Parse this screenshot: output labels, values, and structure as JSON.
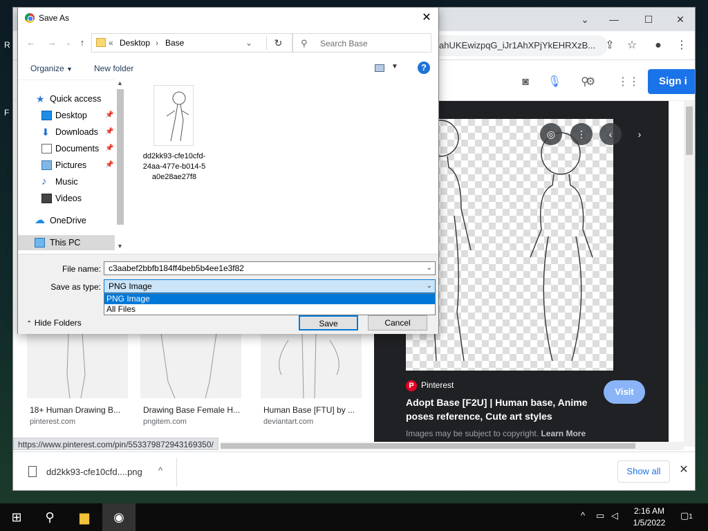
{
  "desktop": {
    "glyphs": [
      "R",
      "F"
    ]
  },
  "browser": {
    "url": "ahUKEwizpqG_iJr1AhXPjYkEHRXzB...",
    "signin_label": "Sign i",
    "status_url": "https://www.pinterest.com/pin/553379872943169350/",
    "thumbs": [
      {
        "title": "18+ Human Drawing B...",
        "source": "pinterest.com"
      },
      {
        "title": "Drawing Base Female H...",
        "source": "pngitem.com"
      },
      {
        "title": "Human Base [FTU] by ...",
        "source": "deviantart.com"
      }
    ],
    "preview": {
      "site": "Pinterest",
      "title": "Adopt Base [F2U] | Human base, Anime poses reference, Cute art styles",
      "visit_label": "Visit",
      "copyright": "Images may be subject to copyright.",
      "learn_more": "Learn More"
    },
    "download": {
      "filename": "dd2kk93-cfe10cfd....png",
      "show_all": "Show all"
    }
  },
  "dialog": {
    "title": "Save As",
    "breadcrumb": [
      "Desktop",
      "Base"
    ],
    "search_placeholder": "Search Base",
    "organize": "Organize",
    "new_folder": "New folder",
    "nav_items": [
      {
        "label": "Quick access",
        "icon": "star-icon",
        "pinned": false
      },
      {
        "label": "Desktop",
        "icon": "desktop-icon",
        "pinned": true
      },
      {
        "label": "Downloads",
        "icon": "download-icon",
        "pinned": true
      },
      {
        "label": "Documents",
        "icon": "documents-icon",
        "pinned": true
      },
      {
        "label": "Pictures",
        "icon": "pictures-icon",
        "pinned": true
      },
      {
        "label": "Music",
        "icon": "music-icon",
        "pinned": false
      },
      {
        "label": "Videos",
        "icon": "videos-icon",
        "pinned": false
      },
      {
        "label": "OneDrive",
        "icon": "cloud-icon",
        "pinned": false
      },
      {
        "label": "This PC",
        "icon": "computer-icon",
        "pinned": false
      }
    ],
    "file": {
      "name": "dd2kk93-cfe10cfd-24aa-477e-b014-5a0e28ae27f8"
    },
    "filename_label": "File name:",
    "filename_value": "c3aabef2bbfb184ff4beb5b4ee1e3f82",
    "savetype_label": "Save as type:",
    "savetype_value": "PNG Image",
    "type_options": [
      "PNG Image",
      "All Files"
    ],
    "hide_folders": "Hide Folders",
    "save_label": "Save",
    "cancel_label": "Cancel"
  },
  "taskbar": {
    "time": "2:16 AM",
    "date": "1/5/2022",
    "notification_count": "1"
  }
}
